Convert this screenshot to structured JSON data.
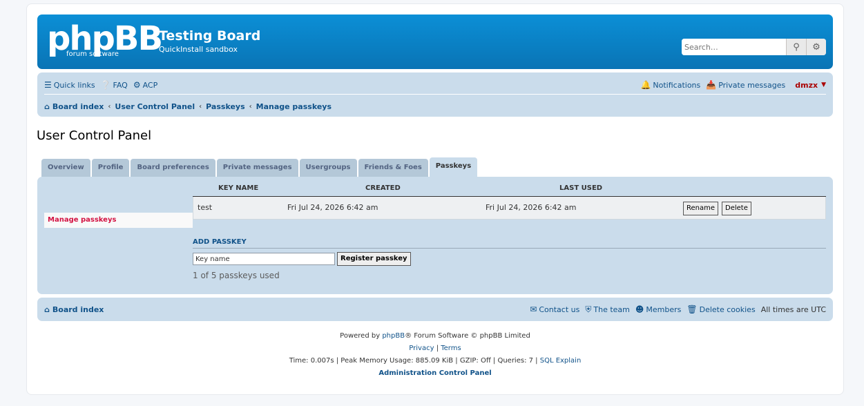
{
  "header": {
    "logo_text": "phpBB",
    "logo_sub": "forum   software",
    "site_title": "Testing Board",
    "site_desc": "QuickInstall sandbox",
    "search_placeholder": "Search…"
  },
  "nav": {
    "quick_links": "Quick links",
    "faq": "FAQ",
    "acp": "ACP",
    "notifications": "Notifications",
    "private_messages": "Private messages",
    "username": "dmzx",
    "breadcrumbs": [
      "Board index",
      "User Control Panel",
      "Passkeys",
      "Manage passkeys"
    ]
  },
  "page_title": "User Control Panel",
  "tabs": [
    "Overview",
    "Profile",
    "Board preferences",
    "Private messages",
    "Usergroups",
    "Friends & Foes",
    "Passkeys"
  ],
  "active_tab": "Passkeys",
  "sidebar": {
    "items": [
      "Manage passkeys"
    ]
  },
  "passkeys_table": {
    "headers": [
      "KEY NAME",
      "CREATED",
      "LAST USED"
    ],
    "rows": [
      {
        "key_name": "test",
        "created": "Fri Jul 24, 2026 6:42 am",
        "last_used": "Fri Jul 24, 2026 6:42 am",
        "rename": "Rename",
        "delete": "Delete"
      }
    ]
  },
  "add_passkey": {
    "heading": "ADD PASSKEY",
    "input_value": "Key name",
    "register_button": "Register passkey",
    "usage": "1 of 5 passkeys used"
  },
  "footer": {
    "board_index": "Board index",
    "contact": "Contact us",
    "team": "The team",
    "members": "Members",
    "delete_cookies": "Delete cookies",
    "timezone": "All times are UTC"
  },
  "copyright": {
    "powered_pre": "Powered by ",
    "powered_link": "phpBB",
    "powered_post": "® Forum Software © phpBB Limited",
    "privacy": "Privacy",
    "sep": " | ",
    "terms": "Terms",
    "debug": "Time: 0.007s | Peak Memory Usage: 885.09 KiB | GZIP: Off | Queries: 7 | ",
    "sql_explain": "SQL Explain",
    "acp_link": "Administration Control Panel"
  },
  "colors": {
    "header_blue": "#0a74b5",
    "nav_bg": "#cadceb",
    "link": "#105289",
    "user": "#aa0000",
    "active_side": "#d31141"
  }
}
